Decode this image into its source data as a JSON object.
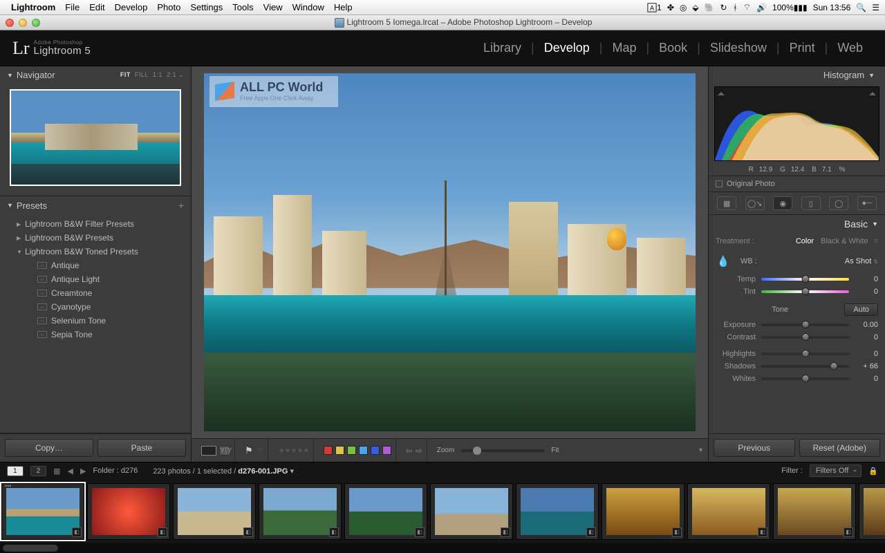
{
  "mac": {
    "app": "Lightroom",
    "menus": [
      "File",
      "Edit",
      "Develop",
      "Photo",
      "Settings",
      "Tools",
      "View",
      "Window",
      "Help"
    ],
    "a_badge": "1",
    "battery": "100%",
    "clock": "Sun 13:56"
  },
  "window": {
    "title": "Lightroom 5 Iomega.lrcat – Adobe Photoshop Lightroom – Develop"
  },
  "header": {
    "brand_small": "Adobe Photoshop",
    "brand": "Lightroom 5",
    "modules": [
      "Library",
      "Develop",
      "Map",
      "Book",
      "Slideshow",
      "Print",
      "Web"
    ],
    "active_module": "Develop"
  },
  "left": {
    "navigator": {
      "title": "Navigator",
      "levels": [
        "FIT",
        "FILL",
        "1:1",
        "2:1"
      ],
      "active": "FIT"
    },
    "presets": {
      "title": "Presets",
      "folders": [
        {
          "name": "Lightroom B&W Filter Presets",
          "open": false
        },
        {
          "name": "Lightroom B&W Presets",
          "open": false
        },
        {
          "name": "Lightroom B&W Toned Presets",
          "open": true,
          "items": [
            "Antique",
            "Antique Light",
            "Creamtone",
            "Cyanotype",
            "Selenium Tone",
            "Sepia Tone"
          ]
        }
      ]
    },
    "copy_btn": "Copy…",
    "paste_btn": "Paste"
  },
  "watermark": {
    "line1": "ALL PC World",
    "line2": "Free Apps One Click Away"
  },
  "toolbar": {
    "zoom_label": "Zoom",
    "fit_label": "Fit",
    "color_swatches": [
      "#d43a3a",
      "#e5c048",
      "#7cc043",
      "#4aa3e8",
      "#3a5ae8",
      "#b05ad6"
    ]
  },
  "right": {
    "histogram": {
      "title": "Histogram",
      "rgb": {
        "r": "12.9",
        "g": "12.4",
        "b": "7.1",
        "pct": "%"
      }
    },
    "original": "Original Photo",
    "basic": {
      "title": "Basic",
      "treatment_label": "Treatment :",
      "treat_color": "Color",
      "treat_bw": "Black & White",
      "wb_label": "WB :",
      "wb_value": "As Shot",
      "temp": {
        "label": "Temp",
        "value": "0"
      },
      "tint": {
        "label": "Tint",
        "value": "0"
      },
      "tone": "Tone",
      "auto": "Auto",
      "exposure": {
        "label": "Exposure",
        "value": "0.00"
      },
      "contrast": {
        "label": "Contrast",
        "value": "0"
      },
      "highlights": {
        "label": "Highlights",
        "value": "0"
      },
      "shadows": {
        "label": "Shadows",
        "value": "+ 66"
      },
      "whites": {
        "label": "Whites",
        "value": "0"
      }
    },
    "prev_btn": "Previous",
    "reset_btn": "Reset (Adobe)"
  },
  "filmstrip": {
    "pages": [
      "1",
      "2"
    ],
    "folder_label": "Folder :",
    "folder": "d276",
    "count": "223 photos / 1 selected /",
    "current": "d276-001.JPG",
    "filter_label": "Filter :",
    "filter_value": "Filters Off",
    "thumbs": 12
  }
}
